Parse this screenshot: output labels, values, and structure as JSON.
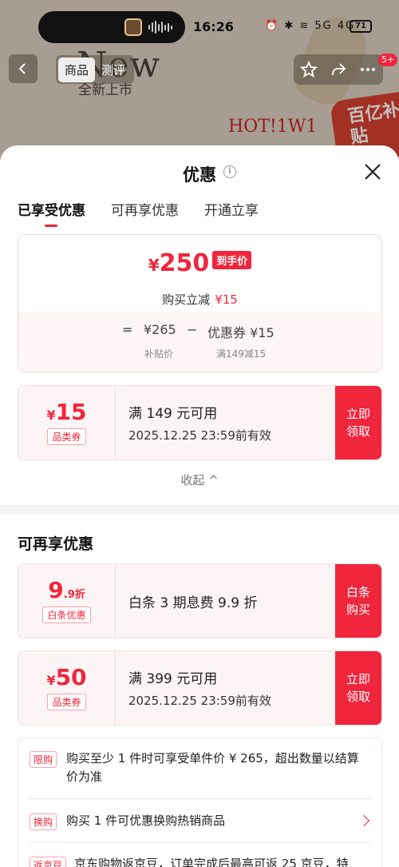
{
  "backdrop": {
    "headline": "New",
    "subline": "全新上市",
    "hot_text": "HOT!1W1",
    "badge_text": "百亿补贴"
  },
  "status_bar": {
    "time": "16:26",
    "icons_text": "⏰ ✱ ≋ 5G 4G",
    "battery": "71"
  },
  "top_bar": {
    "tabs": [
      "商品",
      "测评"
    ],
    "notification_count": "5+"
  },
  "sheet": {
    "title": "优惠",
    "tabs": [
      "已享受优惠",
      "可再享优惠",
      "开通立享"
    ],
    "price_card": {
      "currency": "¥",
      "final_price": "250",
      "final_tag": "到手价",
      "discount_label": "购买立减",
      "discount_value": "¥15",
      "calc_eq": "=",
      "calc_base": "¥265",
      "calc_minus": "−",
      "calc_coupon": "优惠券 ¥15",
      "calc_base_label": "补贴价",
      "calc_coupon_label": "满149减15"
    },
    "coupon_used": {
      "currency": "¥",
      "amount": "15",
      "type": "品类券",
      "condition": "满 149 元可用",
      "validity": "2025.12.25 23:59前有效",
      "button": "立即领取"
    },
    "collapse_label": "收起 ^",
    "more_title": "可再享优惠",
    "more_coupons": [
      {
        "amount": "9",
        "suffix": ".9折",
        "type": "白条优惠",
        "condition": "白条 3 期息费 9.9 折",
        "button": "白条购买"
      },
      {
        "currency": "¥",
        "amount": "50",
        "type": "品类券",
        "condition": "满 399 元可用",
        "validity": "2025.12.25 23:59前有效",
        "button": "立即领取"
      }
    ],
    "promos": [
      {
        "tag": "限购",
        "text": "购买至少 1 件时可享受单件价 ¥ 265，超出数量以结算价为准"
      },
      {
        "tag": "换购",
        "text": "购买 1 件可优惠换购热销商品"
      },
      {
        "tag": "返京豆",
        "text": "京东购物返京豆，订单完成后最高可返 25 京豆，特"
      }
    ]
  },
  "colors": {
    "accent": "#f0263c",
    "coupon_bg": "#fdf4f5"
  }
}
